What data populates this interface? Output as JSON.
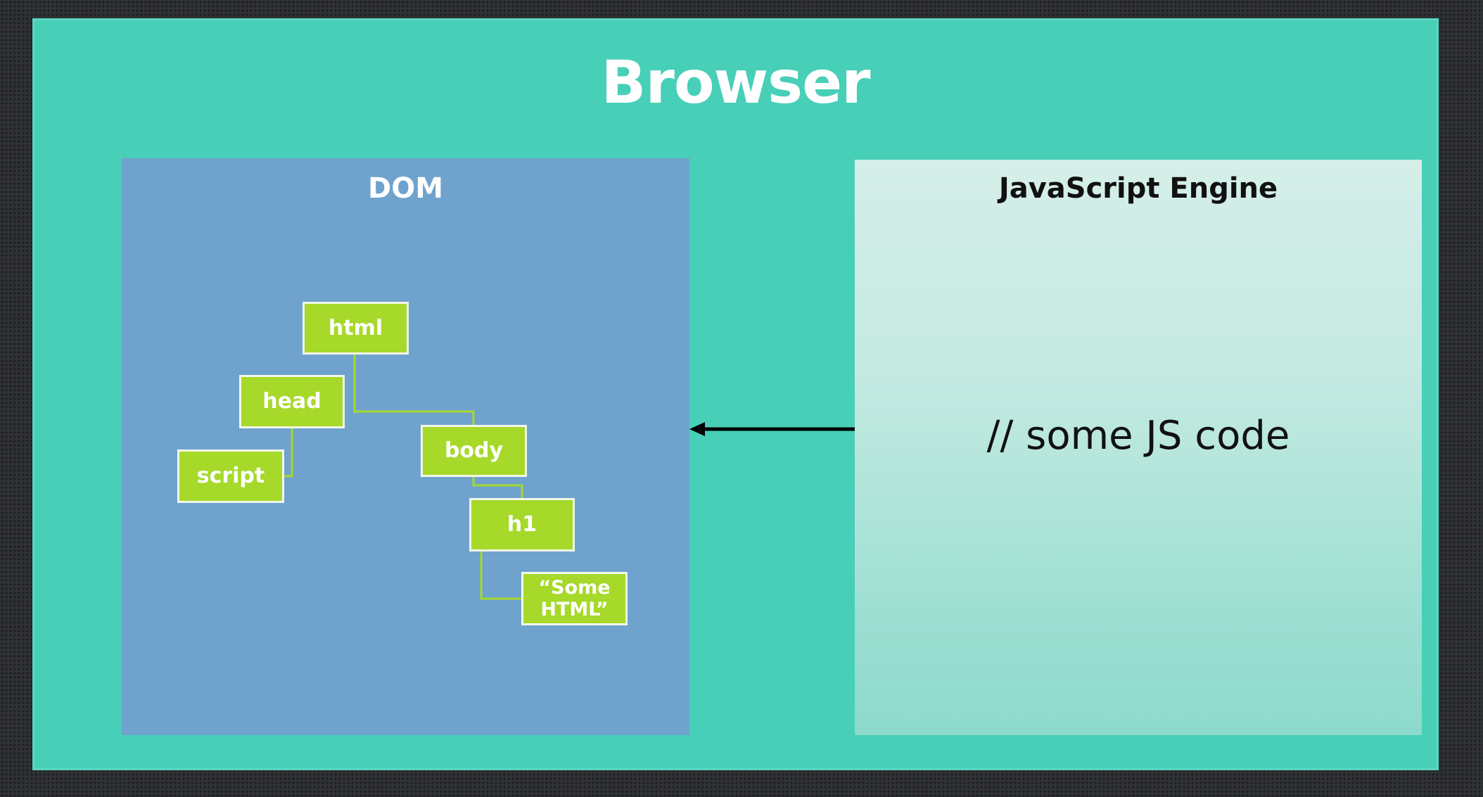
{
  "browser": {
    "title": "Browser"
  },
  "dom": {
    "title": "DOM",
    "nodes": {
      "html": "html",
      "head": "head",
      "script": "script",
      "body": "body",
      "h1": "h1",
      "text": "“Some\nHTML”"
    }
  },
  "js_engine": {
    "title": "JavaScript Engine",
    "code": "// some JS code"
  },
  "colors": {
    "browser_bg": "#48cfb8",
    "dom_bg": "#6fa3cd",
    "node_fill": "#a6d92a",
    "node_border": "#f2f7e8",
    "connector": "#a6d92a",
    "js_bg_top": "#d6eee9",
    "js_bg_bottom": "#8cdacc",
    "arrow": "#000000"
  }
}
